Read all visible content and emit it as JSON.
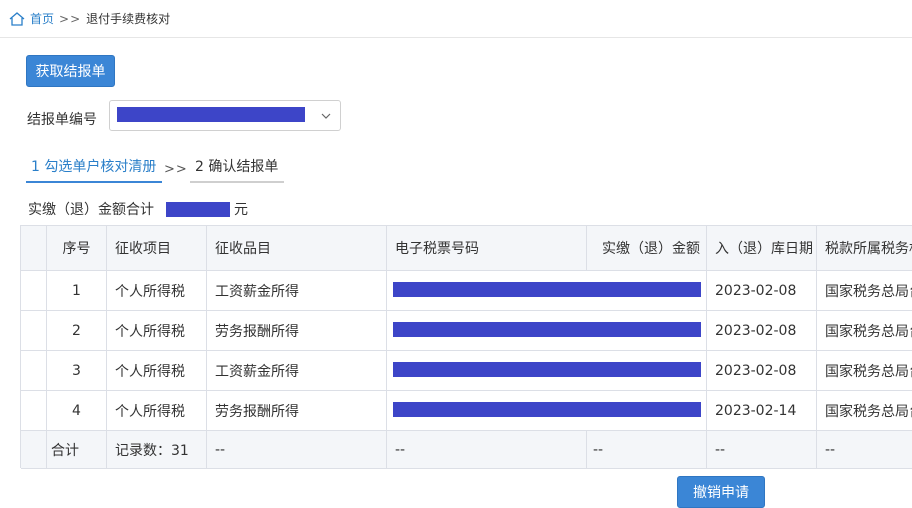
{
  "breadcrumb": {
    "home_label": "首页",
    "separator": ">>",
    "current": "退付手续费核对"
  },
  "toolbar": {
    "fetch_label": "获取结报单"
  },
  "form": {
    "report_label": "结报单编号",
    "report_value_redacted": true
  },
  "steps": {
    "step1": "1 勾选单户核对清册",
    "arrow": ">>",
    "step2": "2 确认结报单",
    "active_step": 1
  },
  "summary": {
    "label": "实缴（退）金额合计",
    "unit": "元",
    "value_redacted": true
  },
  "table": {
    "headers": [
      "序号",
      "征收项目",
      "征收品目",
      "电子税票号码",
      "实缴（退）金额",
      "入（退）库日期",
      "税款所属税务机关"
    ],
    "rows": [
      {
        "no": "1",
        "item": "个人所得税",
        "category": "工资薪金所得",
        "date": "2023-02-08",
        "authority": "国家税务总局台"
      },
      {
        "no": "2",
        "item": "个人所得税",
        "category": "劳务报酬所得",
        "date": "2023-02-08",
        "authority": "国家税务总局台"
      },
      {
        "no": "3",
        "item": "个人所得税",
        "category": "工资薪金所得",
        "date": "2023-02-08",
        "authority": "国家税务总局台"
      },
      {
        "no": "4",
        "item": "个人所得税",
        "category": "劳务报酬所得",
        "date": "2023-02-14",
        "authority": "国家税务总局台"
      }
    ],
    "footer": {
      "label": "合计",
      "count": "记录数：31",
      "placeholder": "--"
    }
  },
  "actions": {
    "cancel_label": "撤销申请"
  },
  "colors": {
    "accent": "#3b86d6",
    "link": "#2a7fc9",
    "redaction": "#3d45c8",
    "header_bg": "#f4f6f9"
  },
  "icons": {
    "home": "home-icon",
    "dropdown": "chevron-down-icon"
  }
}
